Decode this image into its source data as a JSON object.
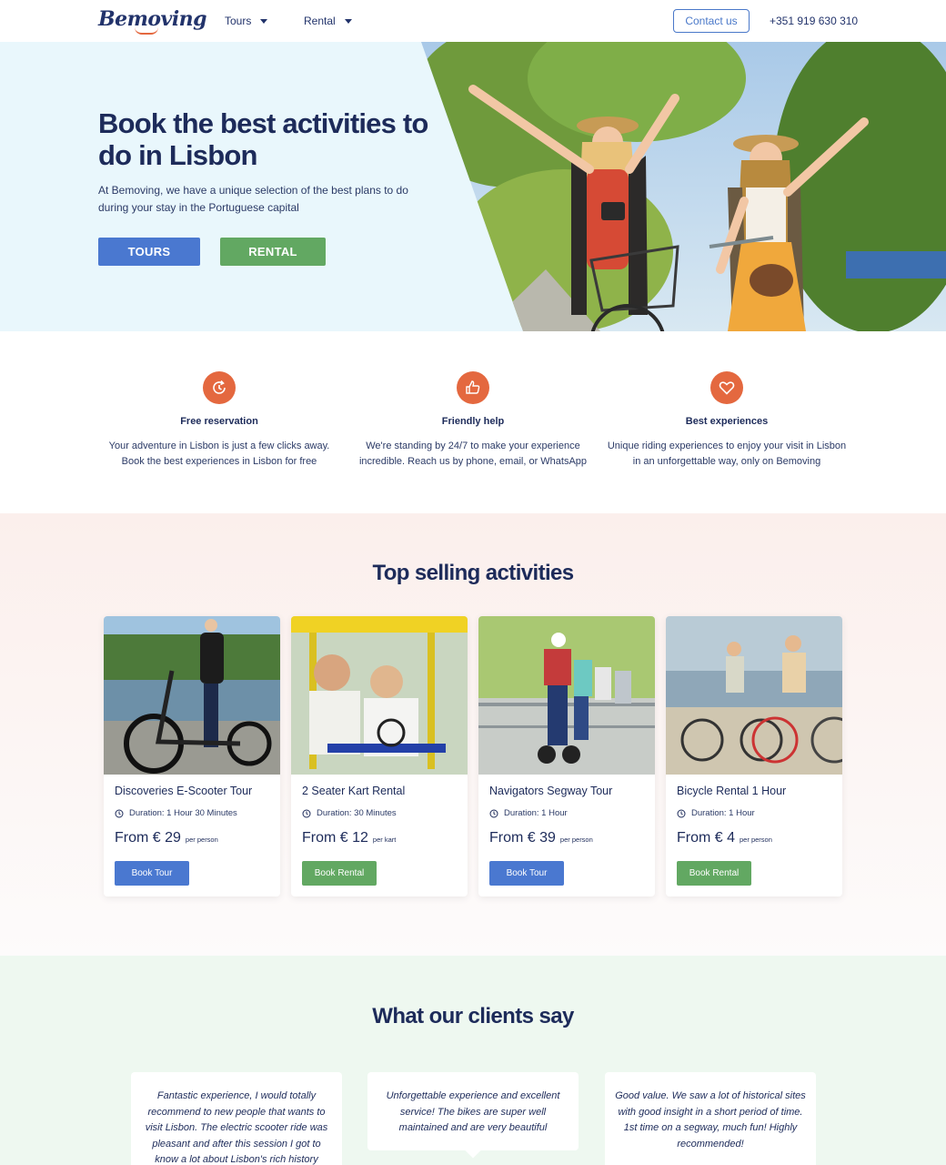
{
  "nav": {
    "logo": "Bemoving",
    "menu": [
      {
        "label": "Tours"
      },
      {
        "label": "Rental"
      }
    ],
    "contact_label": "Contact us",
    "phone": "+351 919 630 310"
  },
  "hero": {
    "title": "Book the best activities to do in Lisbon",
    "subtitle": "At Bemoving, we have a unique selection of the best plans to do during your stay in the Portuguese capital",
    "tours_button": "TOURS",
    "rental_button": "RENTAL"
  },
  "features": [
    {
      "icon": "clock-refresh-icon",
      "title": "Free reservation",
      "text": "Your adventure in Lisbon is just a few clicks away. Book the best experiences in Lisbon for free"
    },
    {
      "icon": "thumbs-up-icon",
      "title": "Friendly help",
      "text": "We're standing by 24/7 to make your experience incredible. Reach us by phone, email, or WhatsApp"
    },
    {
      "icon": "heart-icon",
      "title": "Best experiences",
      "text": "Unique riding experiences to enjoy your visit in Lisbon in an unforgettable way, only on Bemoving"
    }
  ],
  "top_selling": {
    "title": "Top selling activities",
    "cards": [
      {
        "title": "Discoveries E-Scooter Tour",
        "duration": "Duration: 1 Hour 30 Minutes",
        "price": "From € 29",
        "unit": "per person",
        "button": "Book Tour",
        "button_color": "#4a78d0"
      },
      {
        "title": "2 Seater Kart Rental",
        "duration": "Duration: 30 Minutes",
        "price": "From € 12",
        "unit": "per kart",
        "button": "Book Rental",
        "button_color": "#62a862"
      },
      {
        "title": "Navigators Segway Tour",
        "duration": "Duration: 1 Hour",
        "price": "From € 39",
        "unit": "per person",
        "button": "Book Tour",
        "button_color": "#4a78d0"
      },
      {
        "title": "Bicycle Rental 1 Hour",
        "duration": "Duration: 1 Hour",
        "price": "From € 4",
        "unit": "per person",
        "button": "Book Rental",
        "button_color": "#62a862"
      }
    ]
  },
  "testimonials": {
    "title": "What our clients say",
    "quotes": [
      {
        "text": "Fantastic experience, I would totally recommend to new people that wants to visit Lisbon. The electric scooter ride was pleasant and after this session I got to know a lot about Lisbon's rich history"
      },
      {
        "text": "Unforgettable experience and excellent service! The bikes are super well maintained and are very beautiful"
      },
      {
        "text": "Good value. We saw a lot of historical sites with good insight in a short period of time. 1st time on a segway, much fun! Highly recommended!"
      }
    ]
  },
  "colors": {
    "navy": "#1d2b5a",
    "accent_orange": "#e4683f",
    "blue_button": "#4a78d0",
    "green_button": "#62a862",
    "hero_bg": "#e9f7fc"
  }
}
